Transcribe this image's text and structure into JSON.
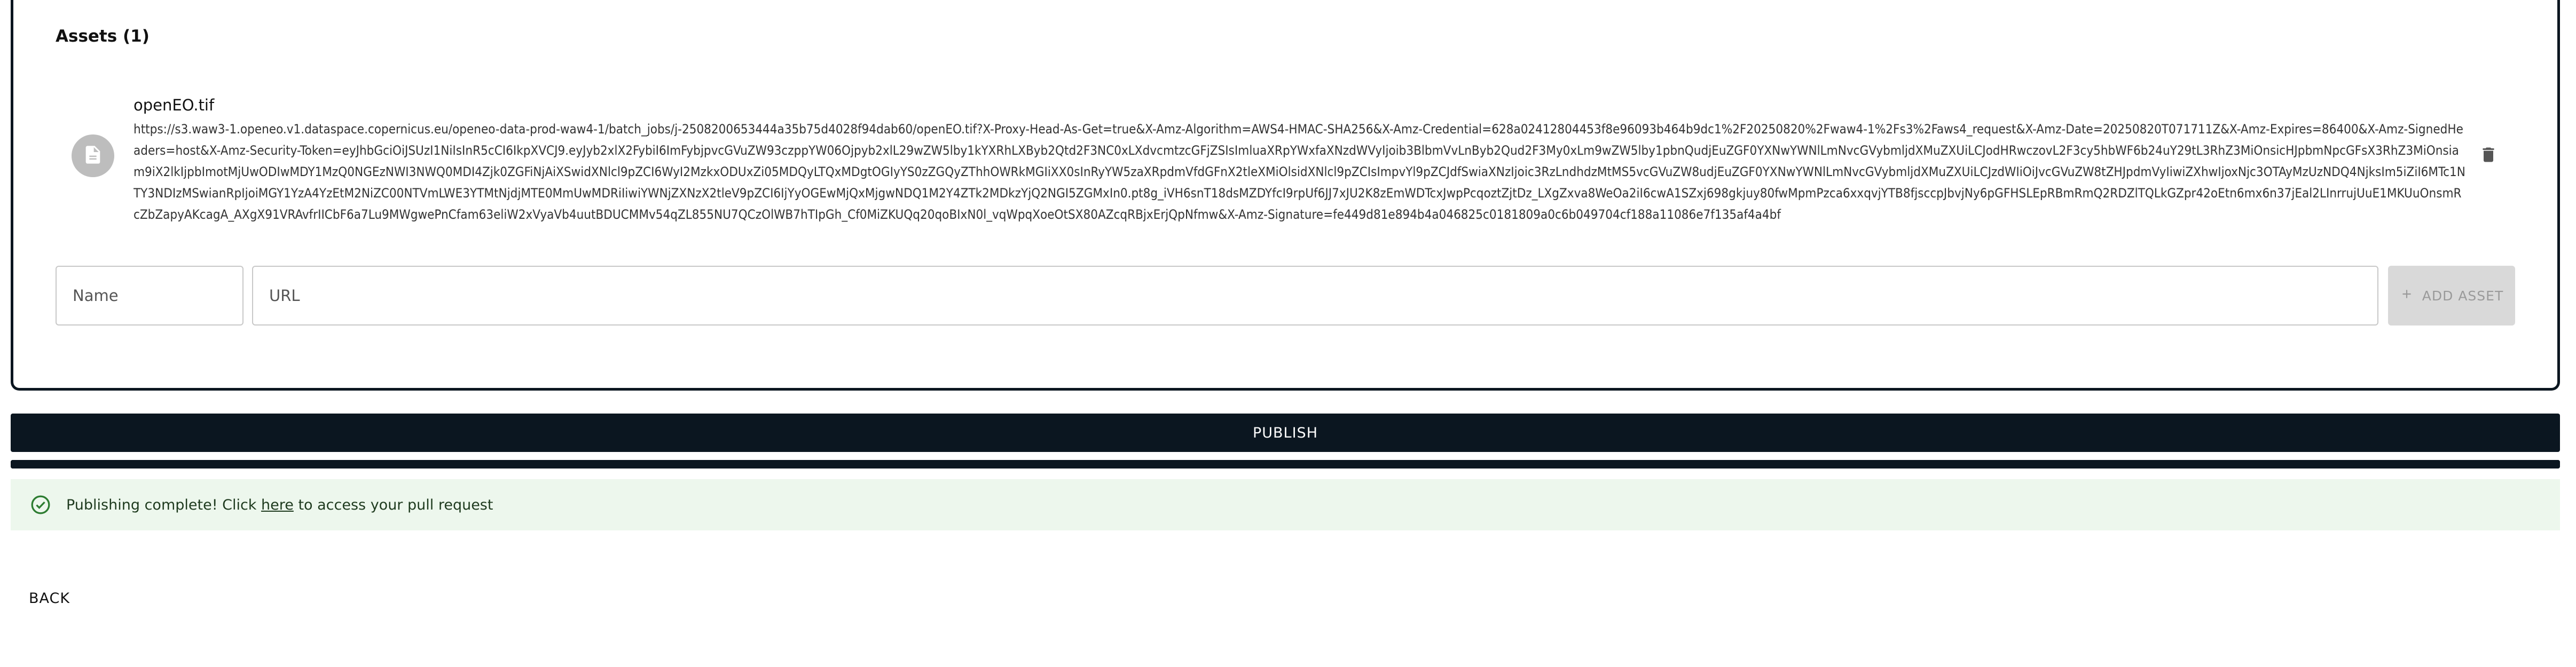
{
  "assets": {
    "title": "Assets (1)",
    "items": [
      {
        "name": "openEO.tif",
        "url": "https://s3.waw3-1.openeo.v1.dataspace.copernicus.eu/openeo-data-prod-waw4-1/batch_jobs/j-2508200653444a35b75d4028f94dab60/openEO.tif?X-Proxy-Head-As-Get=true&X-Amz-Algorithm=AWS4-HMAC-SHA256&X-Amz-Credential=628a02412804453f8e96093b464b9dc1%2F20250820%2Fwaw4-1%2Fs3%2Faws4_request&X-Amz-Date=20250820T071711Z&X-Amz-Expires=86400&X-Amz-SignedHeaders=host&X-Amz-Security-Token=eyJhbGciOiJSUzI1NiIsInR5cCI6IkpXVCJ9.eyJyb2xlX2FybiI6ImFybjpvcGVuZW93czppYW06Ojpyb2xlL29wZW5lby1kYXRhLXByb2Qtd2F3NC0xLXdvcmtzcGFjZSIsImluaXRpYWxfaXNzdWVyIjoib3BlbmVvLnByb2Qud2F3My0xLm9wZW5lby1pbnQudjEuZGF0YXNwYWNlLmNvcGVybmljdXMuZXUiLCJodHRwczovL2F3cy5hbWF6b24uY29tL3RhZ3MiOnsicHJpbmNpcGFsX3RhZ3MiOnsiam9iX2lkIjpbImotMjUwODIwMDY1MzQ0NGEzNWI3NWQ0MDI4Zjk0ZGFiNjAiXSwidXNlcl9pZCI6WyI2MzkxODUxZi05MDQyLTQxMDgtOGIyYS0zZGQyZThhOWRkMGIiXX0sInRyYW5zaXRpdmVfdGFnX2tleXMiOlsidXNlcl9pZCIsImpvYl9pZCJdfSwiaXNzIjoic3RzLndhdzMtMS5vcGVuZW8udjEuZGF0YXNwYWNlLmNvcGVybmljdXMuZXUiLCJzdWIiOiJvcGVuZW8tZHJpdmVyIiwiZXhwIjoxNjc3OTAyMzUzNDQ4NjksIm5iZiI6MTc1NTY3NDIzMSwianRpIjoiMGY1YzA4YzEtM2NiZC00NTVmLWE3YTMtNjdjMTE0MmUwMDRiIiwiYWNjZXNzX2tleV9pZCI6IjYyOGEwMjQxMjgwNDQ1M2Y4ZTk2MDkzYjQ2NGI5ZGMxIn0.pt8g_iVH6snT18dsMZDYfcI9rpUf6JJ7xJU2K8zEmWDTcxJwpPcqoztZjtDz_LXgZxva8WeOa2iI6cwA1SZxj698gkjuy80fwMpmPzca6xxqvjYTB8fjsccpJbvjNy6pGFHSLEpRBmRmQ2RDZlTQLkGZpr42oEtn6mx6n37jEal2LInrrujUuE1MKUuOnsmRcZbZapyAKcagA_AXgX91VRAvfrIICbF6a7Lu9MWgwePnCfam63eliW2xVyaVb4uutBDUCMMv54qZL855NU7QCzOlWB7hTIpGh_Cf0MiZKUQq20qoBIxN0l_vqWpqXoeOtSX80AZcqRBjxErjQpNfmw&X-Amz-Signature=fe449d81e894b4a046825c0181809a0c6b049704cf188a11086e7f135af4a4bf"
      }
    ]
  },
  "form": {
    "name_placeholder": "Name",
    "url_placeholder": "URL",
    "add_asset_label": "ADD ASSET"
  },
  "publish": {
    "label": "PUBLISH",
    "progress": 1.0
  },
  "alert": {
    "prefix": "Publishing complete! Click ",
    "link": "here",
    "suffix": " to access your pull request"
  },
  "back_label": "BACK",
  "colors": {
    "primary": "#0b1620",
    "success_bg": "#edf7ed",
    "success_icon": "#2e7d32",
    "disabled_bg": "#d9d9d9",
    "disabled_text": "#9a9a9a"
  },
  "icons": {
    "asset": "file-icon",
    "delete": "trash-icon",
    "add": "plus-icon",
    "success": "check-circle-icon"
  }
}
